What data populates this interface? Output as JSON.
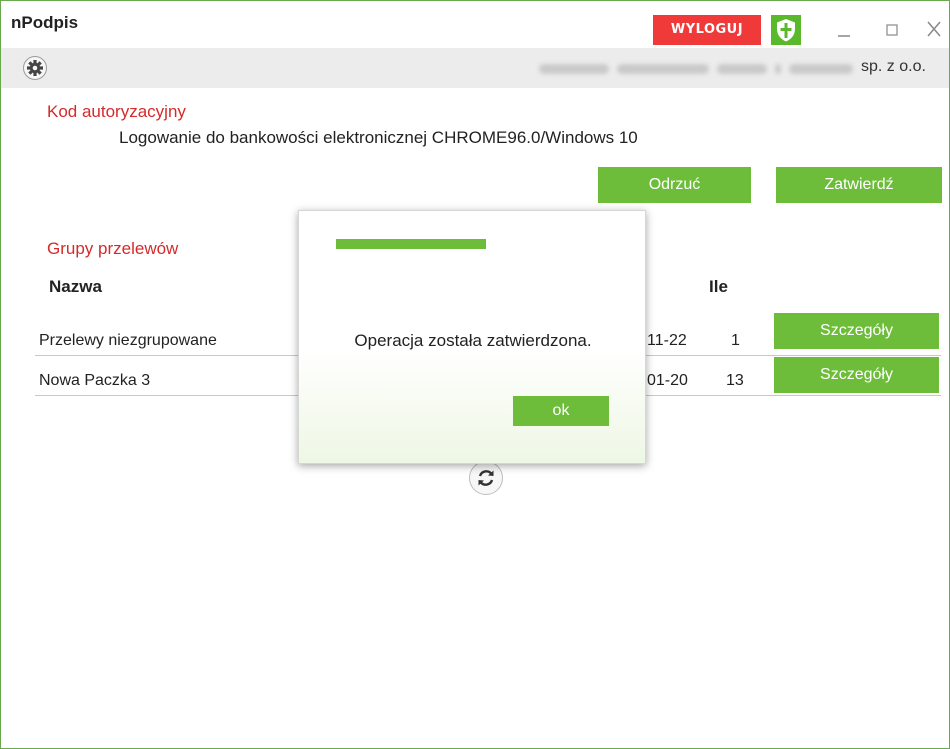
{
  "window": {
    "title": "nPodpis"
  },
  "header": {
    "logout_label": "WYLOGUJ",
    "company_suffix": "sp. z o.o.",
    "icons": [
      "shield-icon",
      "minimize-icon",
      "maximize-icon",
      "close-icon",
      "gear-icon"
    ]
  },
  "auth": {
    "section_title": "Kod autoryzacyjny",
    "description": "Logowanie do bankowości elektronicznej CHROME96.0/Windows 10",
    "reject_label": "Odrzuć",
    "confirm_label": "Zatwierdź"
  },
  "groups": {
    "section_title": "Grupy przelewów",
    "columns": {
      "name": "Nazwa",
      "count": "Ile"
    },
    "rows": [
      {
        "name": "Przelewy niezgrupowane",
        "date": "11-22",
        "count": "1",
        "details_label": "Szczegóły"
      },
      {
        "name": "Nowa Paczka 3",
        "date": "01-20",
        "count": "13",
        "details_label": "Szczegóły"
      }
    ]
  },
  "dialog": {
    "message": "Operacja została zatwierdzona.",
    "ok_label": "ok"
  },
  "colors": {
    "accent_green": "#6dbd3a",
    "logout_red": "#f03a3a",
    "section_red": "#d42a2a"
  }
}
